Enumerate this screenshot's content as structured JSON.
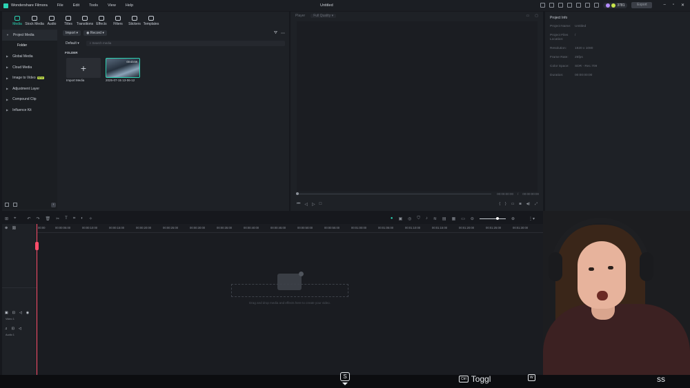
{
  "app": {
    "name": "Wondershare Filmora",
    "window_title": "Untitled",
    "menu": [
      "File",
      "Edit",
      "Tools",
      "View",
      "Help"
    ],
    "credits": "3781",
    "export_label": "Export"
  },
  "media_tabs": [
    {
      "label": "Media",
      "active": true
    },
    {
      "label": "Stock Media"
    },
    {
      "label": "Audio"
    },
    {
      "label": "Titles"
    },
    {
      "label": "Transitions"
    },
    {
      "label": "Effects"
    },
    {
      "label": "Filters"
    },
    {
      "label": "Stickers"
    },
    {
      "label": "Templates"
    }
  ],
  "sidebar": {
    "items": [
      {
        "label": "Project Media"
      },
      {
        "label": "Folder"
      },
      {
        "label": "Global Media"
      },
      {
        "label": "Cloud Media"
      },
      {
        "label": "Image to Video",
        "badge": "NEW"
      },
      {
        "label": "Adjustment Layer"
      },
      {
        "label": "Compound Clip"
      },
      {
        "label": "Influence Kit"
      }
    ]
  },
  "media": {
    "import_label": "Import",
    "record_label": "Record",
    "sort_label": "Default",
    "search_placeholder": "Search media",
    "folder_heading": "FOLDER",
    "items": [
      {
        "label": "Import Media",
        "icon": "+"
      },
      {
        "label": "2025-07-15 13-06-12",
        "duration": "00:43:59"
      }
    ]
  },
  "player": {
    "label": "Player",
    "quality": "Full Quality",
    "time_current": "00:00:00:00",
    "time_total": "00:00:00:00"
  },
  "project_info": {
    "title": "Project Info",
    "rows": [
      {
        "key": "Project Name:",
        "value": "Untitled"
      },
      {
        "key": "Project Files Location:",
        "value": "/"
      },
      {
        "key": "Resolution:",
        "value": "1920 x 1080"
      },
      {
        "key": "Frame Rate:",
        "value": "25fps"
      },
      {
        "key": "Color Space:",
        "value": "SDR - Rec.709"
      },
      {
        "key": "Duration:",
        "value": "00:00:00:00"
      }
    ]
  },
  "timeline": {
    "ruler": [
      "00:00",
      "00:00:05:00",
      "00:00:10:00",
      "00:00:15:00",
      "00:00:20:00",
      "00:00:25:00",
      "00:00:30:00",
      "00:00:35:00",
      "00:00:40:00",
      "00:00:45:00",
      "00:00:50:00",
      "00:00:55:00",
      "00:01:00:00",
      "00:01:05:00",
      "00:01:10:00",
      "00:01:15:00",
      "00:01:20:00",
      "00:01:25:00",
      "00:01:30:00"
    ],
    "tracks": [
      {
        "name": "Video 1"
      },
      {
        "name": "Audio 1"
      }
    ],
    "drop_hint": "Drag and drop media and effects here to create your video."
  },
  "overlay": {
    "s_key": "S",
    "key_ctrl": "Ctrl",
    "toast_text": "Toggl",
    "key_w": "W",
    "toast_tail": "ss"
  },
  "colors": {
    "accent": "#2bd4b4",
    "playhead": "#ff4d6a",
    "new_badge": "#c8e64b"
  }
}
